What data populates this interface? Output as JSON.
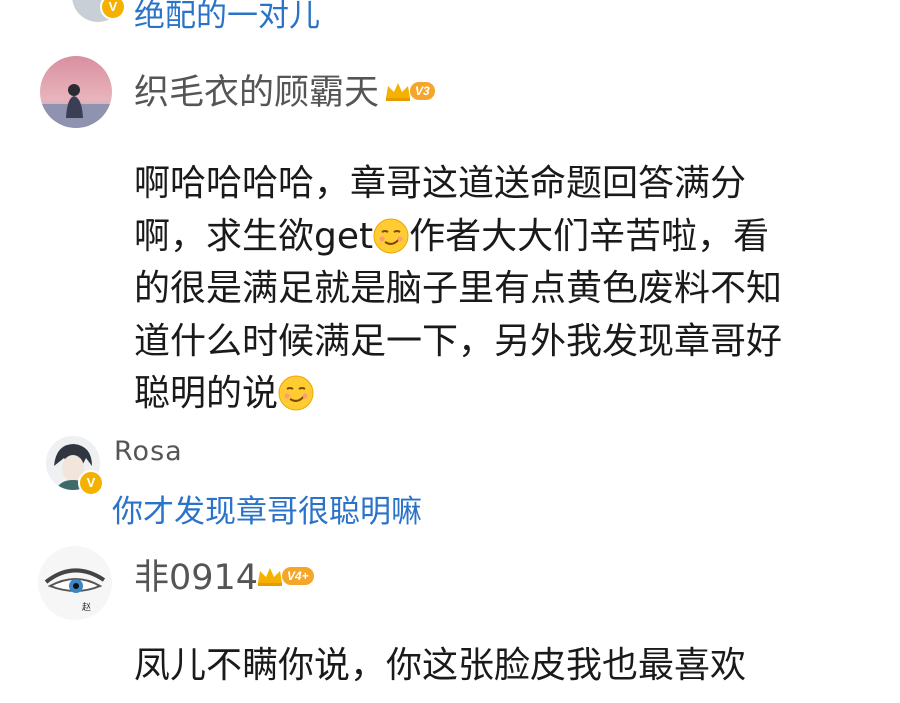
{
  "top_reply": {
    "text": "绝配的一对儿"
  },
  "comments": [
    {
      "username": "织毛衣的顾霸天",
      "vip_level": "V3",
      "text_lines": [
        "啊哈哈哈哈，章哥这道送命题回答满分",
        "啊，求生欲get",
        "作者大大们辛苦啦，看",
        "的很是满足就是脑子里有点黄色废料不知",
        "道什么时候满足一下，另外我发现章哥好",
        "聪明的说"
      ]
    },
    {
      "username": "非0914",
      "vip_level": "V4+",
      "text_lines": [
        "凤儿不瞒你说，你这张脸皮我也最喜欢"
      ]
    }
  ],
  "reply": {
    "username": "Rosa",
    "badge": "V",
    "text": "你才发现章哥很聪明嘛"
  },
  "icons": {
    "crown": "crown-icon",
    "emoji": "smirk-emoji-icon",
    "verified": "verified-v-icon"
  },
  "colors": {
    "link_blue": "#2a73c9",
    "badge_gold": "#f5b100",
    "text": "#1a1a1a"
  }
}
